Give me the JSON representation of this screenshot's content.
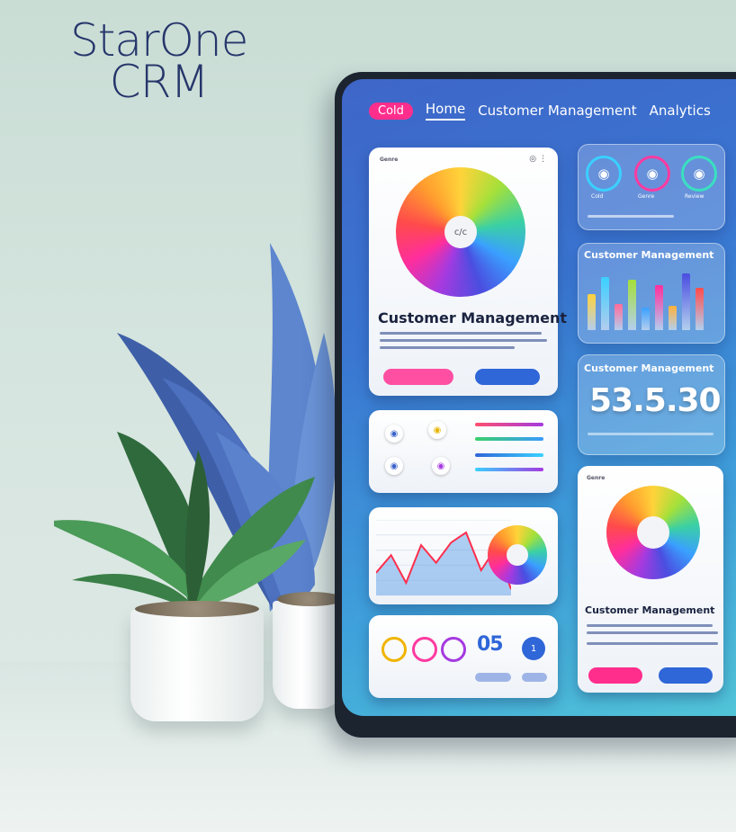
{
  "brand": {
    "line1": "StarOne",
    "line2": "CRM"
  },
  "nav": {
    "pill": "Cold",
    "links": [
      "Home",
      "Customer Management",
      "Analytics"
    ]
  },
  "main_card": {
    "header": "Genre",
    "wheel_center": "c/c",
    "title": "Customer Management",
    "primary_button": "",
    "secondary_button": ""
  },
  "right_top_card": {
    "labels": [
      "Cold",
      "Genre",
      "Review"
    ]
  },
  "bar_card": {
    "title": "Customer Management",
    "chart_data": {
      "type": "bar",
      "values": [
        55,
        82,
        40,
        78,
        35,
        70,
        38,
        88,
        65
      ]
    }
  },
  "stat_card": {
    "title": "Customer Management",
    "value": "53.5.30"
  },
  "line_card": {
    "chart_data": {
      "type": "line",
      "values": [
        42,
        28,
        50,
        20,
        34,
        18,
        10,
        40,
        22,
        55
      ]
    }
  },
  "bottom_card": {
    "big": "05"
  },
  "right_bottom_card": {
    "header": "Genre",
    "title": "Customer Management"
  },
  "colors": {
    "accent_pink": "#ff2e8c",
    "accent_blue": "#2f66d8",
    "brand": "#26366b"
  }
}
